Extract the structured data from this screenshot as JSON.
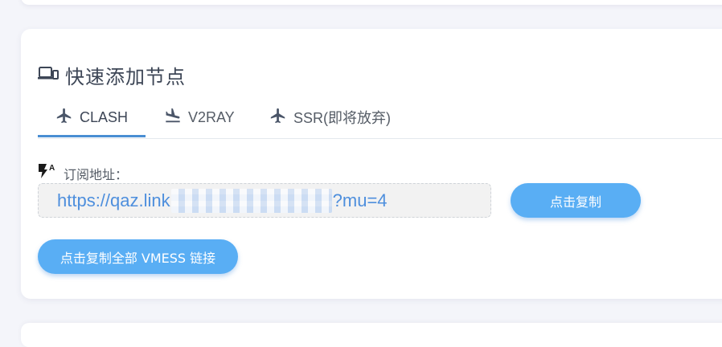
{
  "section": {
    "title": "快速添加节点",
    "icon": "devices-icon"
  },
  "tabs": [
    {
      "label": "CLASH",
      "icon": "airplane-icon",
      "active": true
    },
    {
      "label": "V2RAY",
      "icon": "flight-land-icon",
      "active": false
    },
    {
      "label": "SSR(即将放弃)",
      "icon": "airplane-icon",
      "active": false
    }
  ],
  "subscription": {
    "label": "订阅地址：",
    "url_prefix": "https://qaz.link",
    "url_suffix": "?mu=4"
  },
  "buttons": {
    "copy": "点击复制",
    "copy_all_vmess": "点击复制全部 VMESS 链接"
  },
  "colors": {
    "accent": "#59aef4",
    "tab_underline": "#4a8ed3",
    "link": "#4e8fdd"
  }
}
